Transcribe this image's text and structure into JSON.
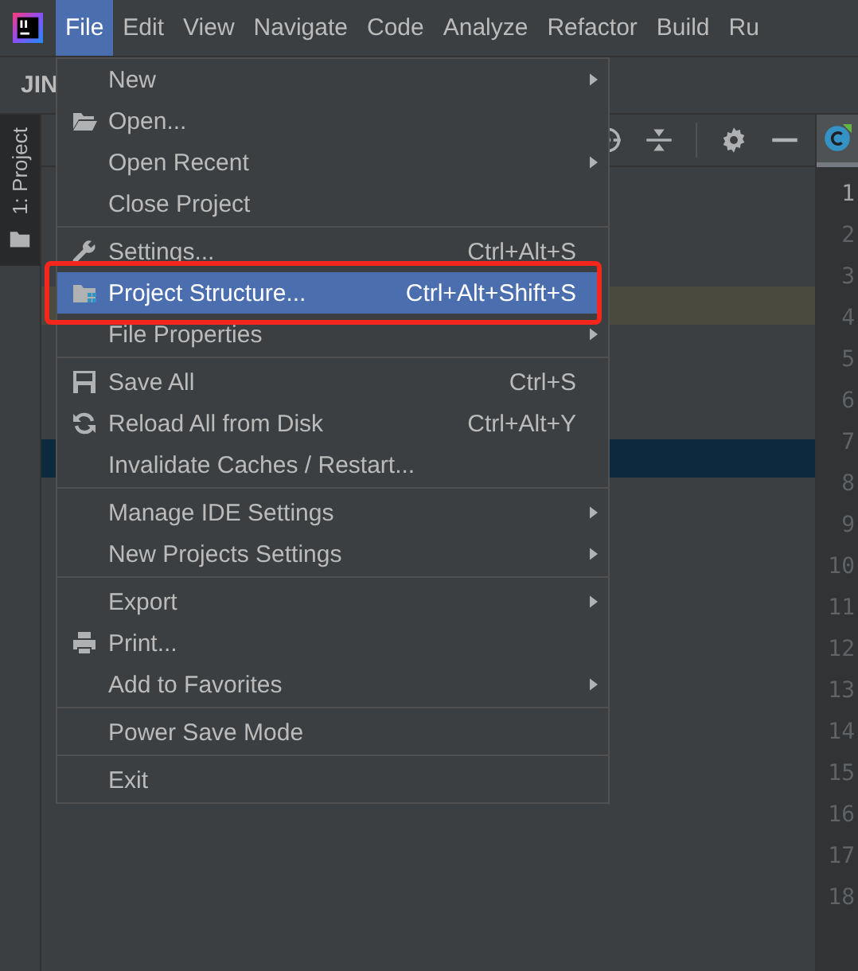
{
  "menu_bar": {
    "items": [
      {
        "label": "File",
        "selected": true
      },
      {
        "label": "Edit",
        "selected": false
      },
      {
        "label": "View",
        "selected": false
      },
      {
        "label": "Navigate",
        "selected": false
      },
      {
        "label": "Code",
        "selected": false
      },
      {
        "label": "Analyze",
        "selected": false
      },
      {
        "label": "Refactor",
        "selected": false
      },
      {
        "label": "Build",
        "selected": false
      },
      {
        "label": "Ru",
        "selected": false
      }
    ]
  },
  "navigation_bar": {
    "project": "JIN"
  },
  "tool_strip": {
    "tab": {
      "label": "1: Project",
      "selected": true
    }
  },
  "project_tree": {
    "rows": [
      {
        "kind": "plain"
      },
      {
        "kind": "plain"
      },
      {
        "kind": "plain"
      },
      {
        "kind": "marked"
      },
      {
        "kind": "plain"
      },
      {
        "kind": "plain"
      },
      {
        "kind": "plain"
      },
      {
        "kind": "selected"
      }
    ]
  },
  "editor": {
    "line_numbers": [
      {
        "text": "1",
        "current": true
      },
      {
        "text": "2",
        "current": false
      },
      {
        "text": "3",
        "current": false
      },
      {
        "text": "4",
        "current": false
      },
      {
        "text": "5",
        "current": false
      },
      {
        "text": "6",
        "current": false
      },
      {
        "text": "7",
        "current": false
      },
      {
        "text": "8",
        "current": false
      },
      {
        "text": "9",
        "current": false
      },
      {
        "text": "10",
        "current": false
      },
      {
        "text": "11",
        "current": false
      },
      {
        "text": "12",
        "current": false
      },
      {
        "text": "13",
        "current": false
      },
      {
        "text": "14",
        "current": false
      },
      {
        "text": "15",
        "current": false
      },
      {
        "text": "16",
        "current": false
      },
      {
        "text": "17",
        "current": false
      },
      {
        "text": "18",
        "current": false
      }
    ]
  },
  "file_menu": {
    "items": [
      {
        "kind": "item",
        "label": "New",
        "submenu": true,
        "selected": false
      },
      {
        "kind": "item",
        "label": "Open...",
        "submenu": false,
        "selected": false
      },
      {
        "kind": "item",
        "label": "Open Recent",
        "submenu": true,
        "selected": false
      },
      {
        "kind": "item",
        "label": "Close Project",
        "submenu": false,
        "selected": false
      },
      {
        "kind": "separator"
      },
      {
        "kind": "item",
        "label": "Settings...",
        "shortcut": "Ctrl+Alt+S",
        "submenu": false,
        "selected": false
      },
      {
        "kind": "item",
        "label": "Project Structure...",
        "shortcut": "Ctrl+Alt+Shift+S",
        "submenu": false,
        "selected": true,
        "annotated": true
      },
      {
        "kind": "item",
        "label": "File Properties",
        "submenu": true,
        "selected": false
      },
      {
        "kind": "separator"
      },
      {
        "kind": "item",
        "label": "Save All",
        "shortcut": "Ctrl+S",
        "submenu": false,
        "selected": false
      },
      {
        "kind": "item",
        "label": "Reload All from Disk",
        "shortcut": "Ctrl+Alt+Y",
        "submenu": false,
        "selected": false
      },
      {
        "kind": "item",
        "label": "Invalidate Caches / Restart...",
        "submenu": false,
        "selected": false
      },
      {
        "kind": "separator"
      },
      {
        "kind": "item",
        "label": "Manage IDE Settings",
        "submenu": true,
        "selected": false
      },
      {
        "kind": "item",
        "label": "New Projects Settings",
        "submenu": true,
        "selected": false
      },
      {
        "kind": "separator"
      },
      {
        "kind": "item",
        "label": "Export",
        "submenu": true,
        "selected": false
      },
      {
        "kind": "item",
        "label": "Print...",
        "submenu": false,
        "selected": false
      },
      {
        "kind": "item",
        "label": "Add to Favorites",
        "submenu": true,
        "selected": false
      },
      {
        "kind": "separator"
      },
      {
        "kind": "item",
        "label": "Power Save Mode",
        "submenu": false,
        "selected": false
      },
      {
        "kind": "separator"
      },
      {
        "kind": "item",
        "label": "Exit",
        "submenu": false,
        "selected": false
      }
    ]
  }
}
